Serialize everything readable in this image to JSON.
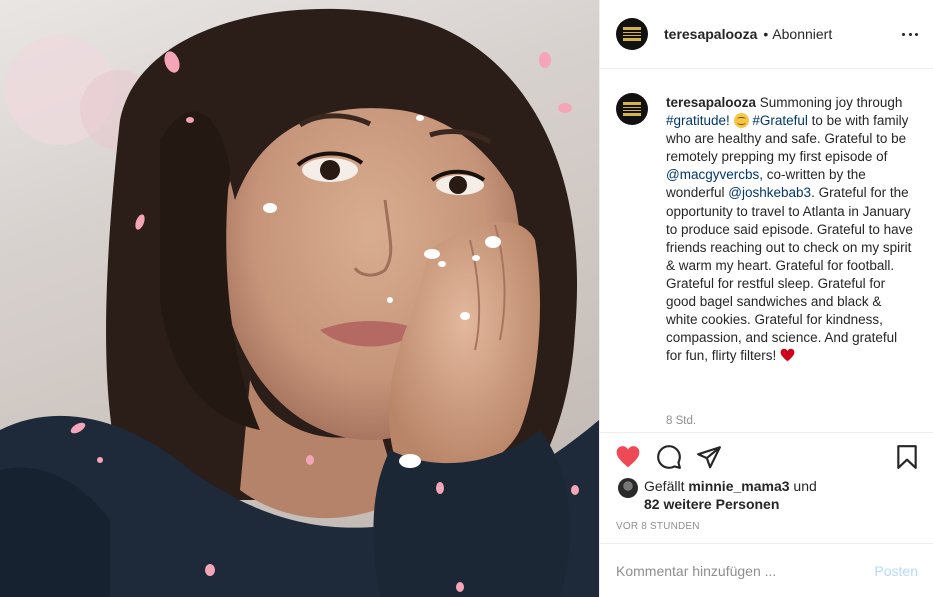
{
  "post": {
    "image_alt": "Selfie of a smiling woman with falling pink petals filter"
  },
  "header": {
    "username": "teresapalooza",
    "separator": "•",
    "follow_status": "Abonniert"
  },
  "caption": {
    "username": "teresapalooza",
    "seg1": " Summoning joy through ",
    "hashtag1": "#gratitude!",
    "seg2": " ",
    "hashtag2": "#Grateful",
    "seg3": " to be with family who are healthy and safe. Grateful to be remotely prepping my first episode of ",
    "mention1": "@macgyvercbs",
    "seg4": ", co-written by the wonderful ",
    "mention2": "@joshkebab3",
    "seg5": ". Grateful for the opportunity to travel to Atlanta in January to produce said episode. Grateful to have friends reaching out to check on my spirit & warm my heart. Grateful for football. Grateful for restful sleep. Grateful for good bagel sandwiches and black & white cookies. Grateful for kindness, compassion, and science. And grateful for fun, flirty filters! ",
    "time": "8 Std."
  },
  "likes": {
    "prefix": "Gefällt ",
    "user": "minnie_mama3",
    "mid": " und",
    "others": "82 weitere Personen"
  },
  "post_time": "VOR 8 STUNDEN",
  "comment": {
    "placeholder": "Kommentar hinzufügen ...",
    "post_label": "Posten"
  },
  "colors": {
    "like_red": "#ed4956",
    "link_blue": "#00376b",
    "post_disabled": "#b3dbff"
  }
}
